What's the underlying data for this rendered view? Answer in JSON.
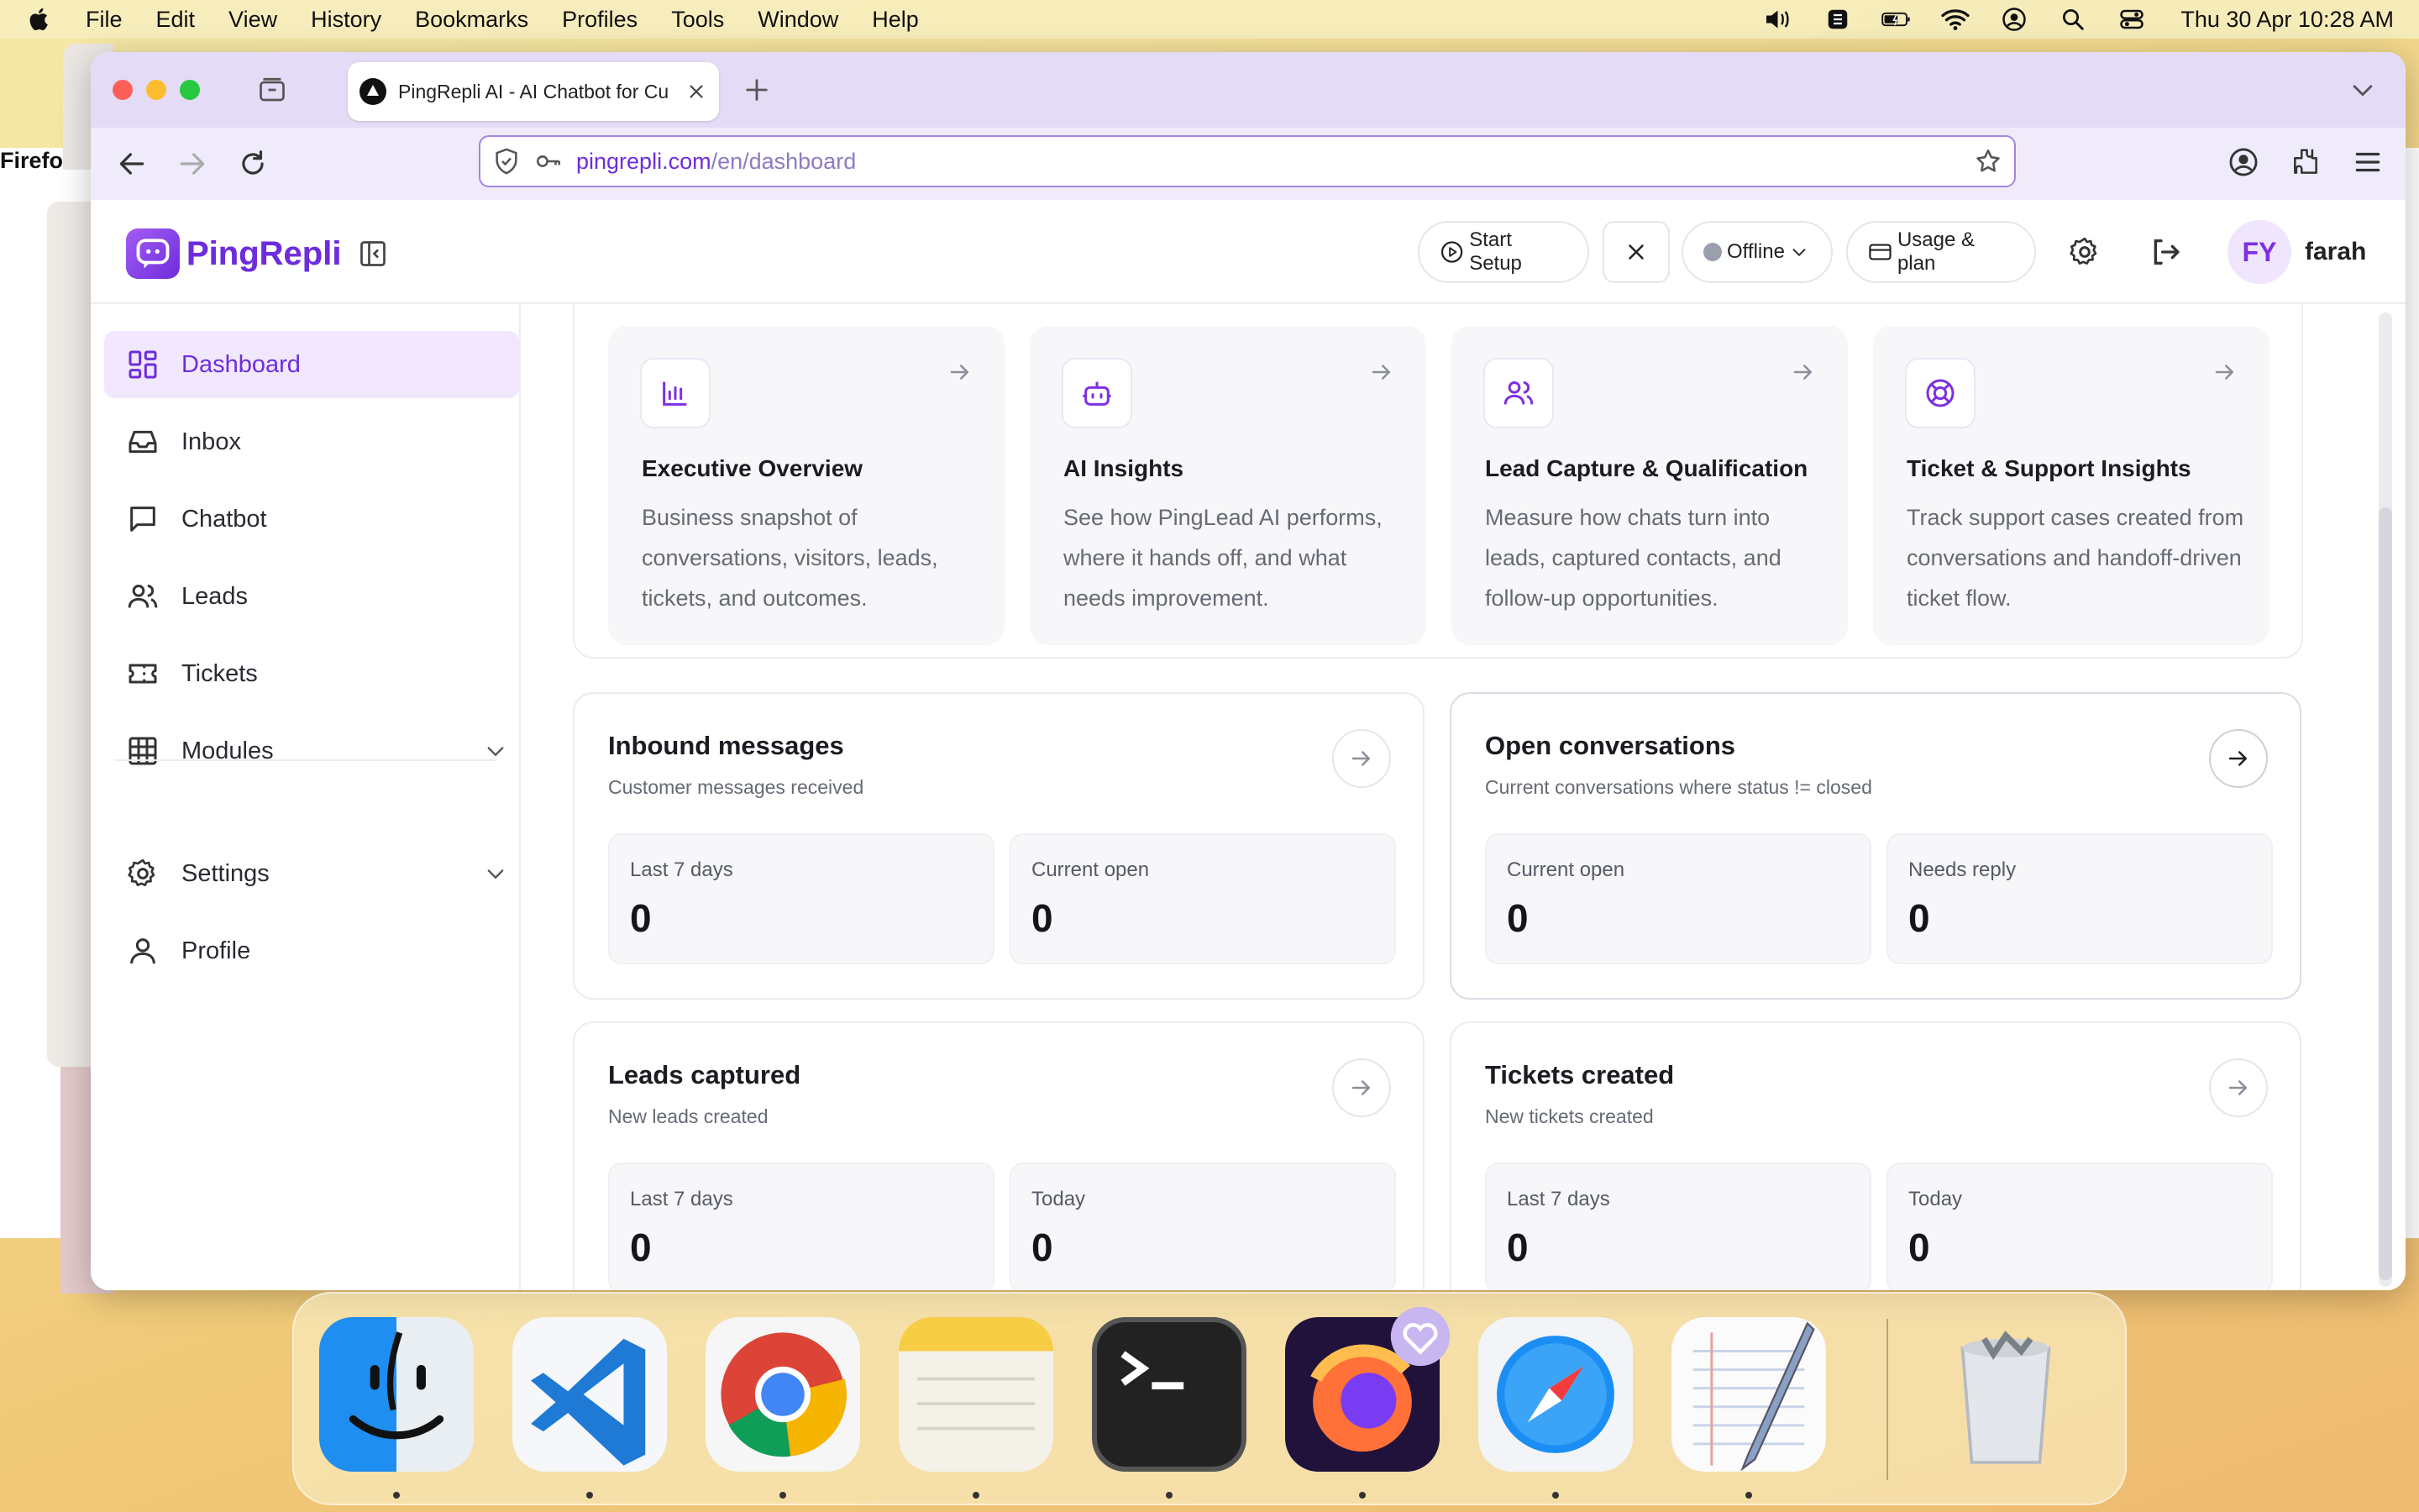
{
  "menubar": {
    "app_name": "Firefox",
    "menus": [
      "File",
      "Edit",
      "View",
      "History",
      "Bookmarks",
      "Profiles",
      "Tools",
      "Window",
      "Help"
    ],
    "clock": "Thu 30 Apr  10:28 AM"
  },
  "browser": {
    "tab_title": "PingRepli AI - AI Chatbot for Cu",
    "url_host": "pingrepli.com",
    "url_path": "/en/dashboard"
  },
  "app": {
    "brand": "PingRepli",
    "header": {
      "start_setup": "Start Setup",
      "status": "Offline",
      "usage_plan": "Usage & plan",
      "avatar_initials": "FY",
      "username": "farah"
    },
    "sidebar": {
      "items": [
        {
          "label": "Dashboard",
          "icon": "dashboard-icon"
        },
        {
          "label": "Inbox",
          "icon": "inbox-icon"
        },
        {
          "label": "Chatbot",
          "icon": "chat-icon"
        },
        {
          "label": "Leads",
          "icon": "users-icon"
        },
        {
          "label": "Tickets",
          "icon": "ticket-icon"
        },
        {
          "label": "Modules",
          "icon": "grid-icon"
        },
        {
          "label": "Settings",
          "icon": "gear-icon"
        },
        {
          "label": "Profile",
          "icon": "user-icon"
        }
      ]
    },
    "feature_cards": [
      {
        "title": "Executive Overview",
        "desc": "Business snapshot of conversations, visitors, leads, tickets, and outcomes.",
        "icon": "bar-chart-icon"
      },
      {
        "title": "AI Insights",
        "desc": "See how PingLead AI performs, where it hands off, and what needs improvement.",
        "icon": "bot-icon"
      },
      {
        "title": "Lead Capture & Qualification",
        "desc": "Measure how chats turn into leads, captured contacts, and follow-up opportunities.",
        "icon": "users-icon"
      },
      {
        "title": "Ticket & Support Insights",
        "desc": "Track support cases created from conversations and handoff-driven ticket flow.",
        "icon": "lifebuoy-icon"
      }
    ],
    "stat_cards": [
      {
        "title": "Inbound messages",
        "subtitle": "Customer messages received",
        "metrics": [
          {
            "label": "Last 7 days",
            "value": "0"
          },
          {
            "label": "Current open",
            "value": "0"
          }
        ]
      },
      {
        "title": "Open conversations",
        "subtitle": "Current conversations where status != closed",
        "metrics": [
          {
            "label": "Current open",
            "value": "0"
          },
          {
            "label": "Needs reply",
            "value": "0"
          }
        ]
      },
      {
        "title": "Leads captured",
        "subtitle": "New leads created",
        "metrics": [
          {
            "label": "Last 7 days",
            "value": "0"
          },
          {
            "label": "Today",
            "value": "0"
          }
        ]
      },
      {
        "title": "Tickets created",
        "subtitle": "New tickets created",
        "metrics": [
          {
            "label": "Last 7 days",
            "value": "0"
          },
          {
            "label": "Today",
            "value": "0"
          }
        ]
      }
    ]
  },
  "dock": {
    "apps": [
      "Finder",
      "Visual Studio Code",
      "Google Chrome",
      "Notes",
      "Terminal",
      "Firefox",
      "Safari",
      "TextEdit",
      "Trash"
    ]
  },
  "colors": {
    "accent": "#6d2ddc",
    "accent_light": "#f1e8fd"
  }
}
